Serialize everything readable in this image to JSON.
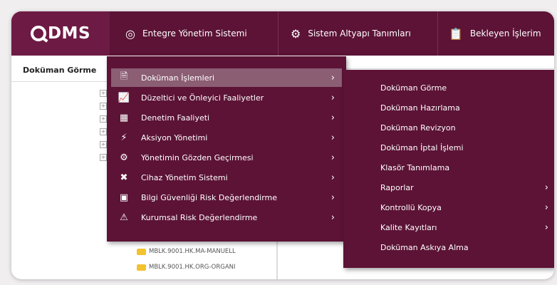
{
  "brand": {
    "logo_text": "DMS"
  },
  "nav": [
    {
      "label": "Entegre Yönetim Sistemi",
      "icon": "circle-icon"
    },
    {
      "label": "Sistem Altyapı Tanımları",
      "icon": "gear-icon"
    },
    {
      "label": "Bekleyen İşlerim",
      "icon": "clipboard-icon"
    }
  ],
  "breadcrumb": "Doküman Görme",
  "menu": [
    {
      "label": "Doküman İşlemleri",
      "icon": "document-icon",
      "active": true
    },
    {
      "label": "Düzeltici ve Önleyici Faaliyetler",
      "icon": "chart-icon"
    },
    {
      "label": "Denetim Faaliyeti",
      "icon": "audit-icon"
    },
    {
      "label": "Aksiyon Yönetimi",
      "icon": "bolt-icon"
    },
    {
      "label": "Yönetimin Gözden Geçirmesi",
      "icon": "review-icon"
    },
    {
      "label": "Cihaz Yönetim Sistemi",
      "icon": "tools-icon"
    },
    {
      "label": "Bilgi Güvenliği Risk Değerlendirme",
      "icon": "lock-icon"
    },
    {
      "label": "Kurumsal Risk Değerlendirme",
      "icon": "alert-icon"
    }
  ],
  "submenu": [
    {
      "label": "Doküman Görme",
      "has_sub": false
    },
    {
      "label": "Doküman Hazırlama",
      "has_sub": false
    },
    {
      "label": "Doküman Revizyon",
      "has_sub": false
    },
    {
      "label": "Doküman İptal İşlemi",
      "has_sub": false
    },
    {
      "label": "Klasör Tanımlama",
      "has_sub": false
    },
    {
      "label": "Raporlar",
      "has_sub": true
    },
    {
      "label": "Kontrollü Kopya",
      "has_sub": true
    },
    {
      "label": "Kalite Kayıtları",
      "has_sub": true
    },
    {
      "label": "Doküman Askıya Alma",
      "has_sub": false
    }
  ],
  "files": [
    "MBLK.9001.HK.MA-MANUELL",
    "MBLK.9001.HK.ORG-ORGANI"
  ],
  "colors": {
    "primary": "#5c1336",
    "logo_bg": "#6d1b44",
    "active": "#8b5e74"
  }
}
